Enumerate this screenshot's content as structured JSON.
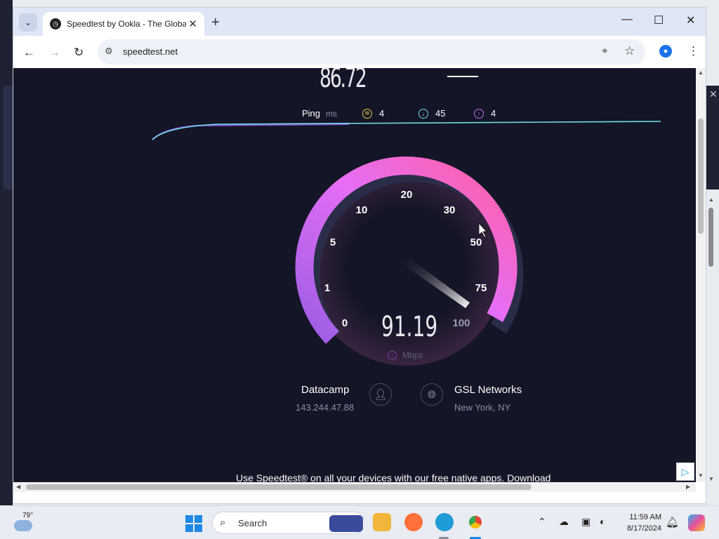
{
  "browser": {
    "tab_title": "Speedtest by Ookla - The Global Broadband Speed Test",
    "url": "speedtest.net",
    "new_tab_symbol": "+",
    "tab_dropdown_symbol": "⌄",
    "close_symbol": "✕"
  },
  "speedtest": {
    "download_value": "86.72",
    "ping": {
      "label": "Ping",
      "unit": "ms",
      "idle": "4",
      "download": "45",
      "upload": "4"
    },
    "gauge": {
      "ticks": [
        "0",
        "1",
        "5",
        "10",
        "20",
        "30",
        "50",
        "75",
        "100"
      ],
      "max": 100
    },
    "current_value": "91.19",
    "current_unit": "Mbps",
    "client": {
      "name": "Datacamp",
      "ip": "143.244.47.88"
    },
    "server": {
      "name": "GSL Networks",
      "location": "New York, NY"
    },
    "promo": "Use Speedtest® on all your devices with our free native apps. Download"
  },
  "taskbar": {
    "temperature": "79°",
    "search_label": "Search",
    "time": "11:59 AM",
    "date": "8/17/2024"
  },
  "colors": {
    "page_bg": "#141526",
    "gauge_start": "#9b5de5",
    "gauge_end": "#ff5fa2",
    "upload_accent": "#7b3fa8",
    "line_purple": "#8a4fd6",
    "line_cyan": "#6fe0e8"
  }
}
